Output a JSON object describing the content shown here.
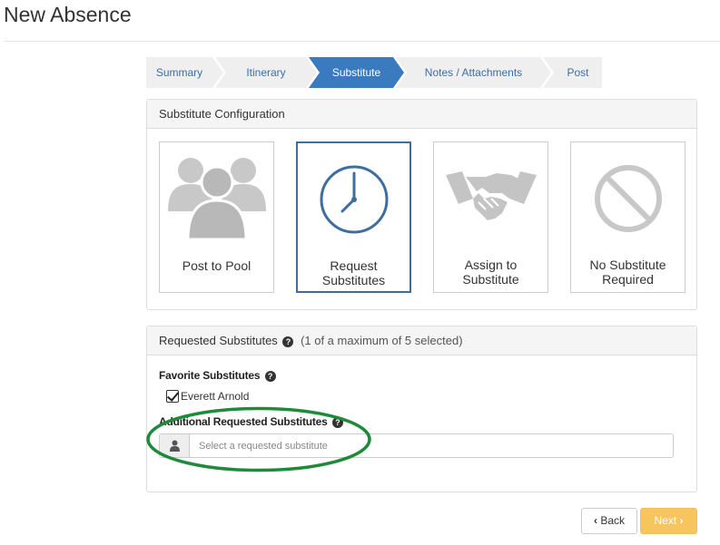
{
  "page": {
    "title": "New Absence"
  },
  "wizard": {
    "steps": [
      {
        "label": "Summary",
        "active": false
      },
      {
        "label": "Itinerary",
        "active": false
      },
      {
        "label": "Substitute",
        "active": true
      },
      {
        "label": "Notes / Attachments",
        "active": false
      },
      {
        "label": "Post",
        "active": false
      }
    ]
  },
  "substitute_config": {
    "heading": "Substitute Configuration",
    "options": [
      {
        "line1": "Post to Pool",
        "line2": "",
        "icon": "group-icon",
        "selected": false
      },
      {
        "line1": "Request",
        "line2": "Substitutes",
        "icon": "clock-icon",
        "selected": true
      },
      {
        "line1": "Assign to",
        "line2": "Substitute",
        "icon": "handshake-icon",
        "selected": false
      },
      {
        "line1": "No Substitute",
        "line2": "Required",
        "icon": "prohibited-icon",
        "selected": false
      }
    ]
  },
  "requested": {
    "heading": "Requested Substitutes",
    "count_text": "(1 of a maximum of 5 selected)",
    "favorites_label": "Favorite Substitutes",
    "favorites": [
      {
        "name": "Everett Arnold",
        "checked": true
      }
    ],
    "additional_label": "Additional Requested Substitutes",
    "search_placeholder": "Select a requested substitute",
    "search_value": ""
  },
  "footer": {
    "back_label": "Back",
    "next_label": "Next"
  },
  "colors": {
    "accent": "#3a7bbf",
    "next": "#f7c55e",
    "highlight": "#1e8a3a"
  }
}
